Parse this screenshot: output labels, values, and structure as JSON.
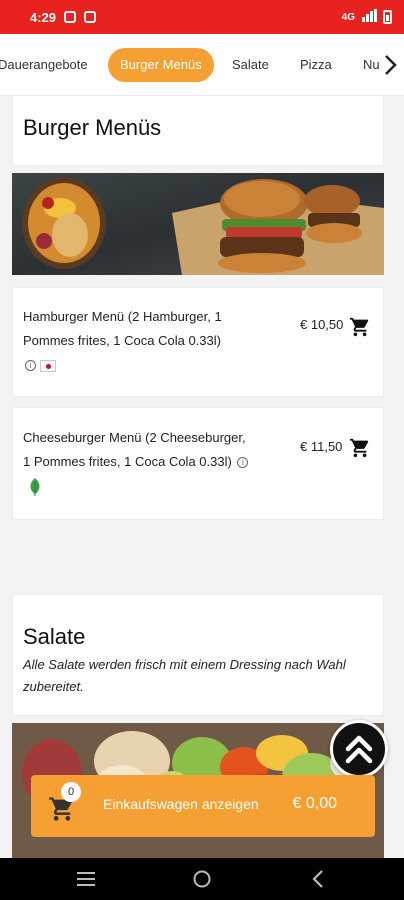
{
  "status_bar": {
    "time": "4:29",
    "network": "4G"
  },
  "tabs": [
    {
      "label": "Dauerangebote",
      "active": false
    },
    {
      "label": "Burger Menüs",
      "active": true
    },
    {
      "label": "Salate",
      "active": false
    },
    {
      "label": "Pizza",
      "active": false
    },
    {
      "label": "Nu",
      "active": false
    }
  ],
  "sections": {
    "burger": {
      "title": "Burger Menüs",
      "items": [
        {
          "name": "Hamburger Menü (2 Hamburger, 1 Pommes frites, 1 Coca Cola 0.33l)",
          "price": "€ 10,50"
        },
        {
          "name": "Cheeseburger Menü (2 Cheeseburger, 1 Pommes frites, 1 Coca Cola 0.33l)",
          "price": "€ 11,50"
        }
      ]
    },
    "salate": {
      "title": "Salate",
      "description": "Alle Salate werden frisch mit einem Dressing nach Wahl zubereitet."
    }
  },
  "cart": {
    "count": "0",
    "label": "Einkaufswagen anzeigen",
    "total": "€ 0,00"
  },
  "icons": {
    "cart": "cart-icon",
    "info": "info-icon",
    "scroll_top": "double-chevron-up-icon",
    "tab_next": "chevron-right-icon"
  },
  "colors": {
    "status_bar": "#e7221f",
    "accent": "#f6a033",
    "veggie": "#3aa14a",
    "scroll_button": "#111111"
  }
}
